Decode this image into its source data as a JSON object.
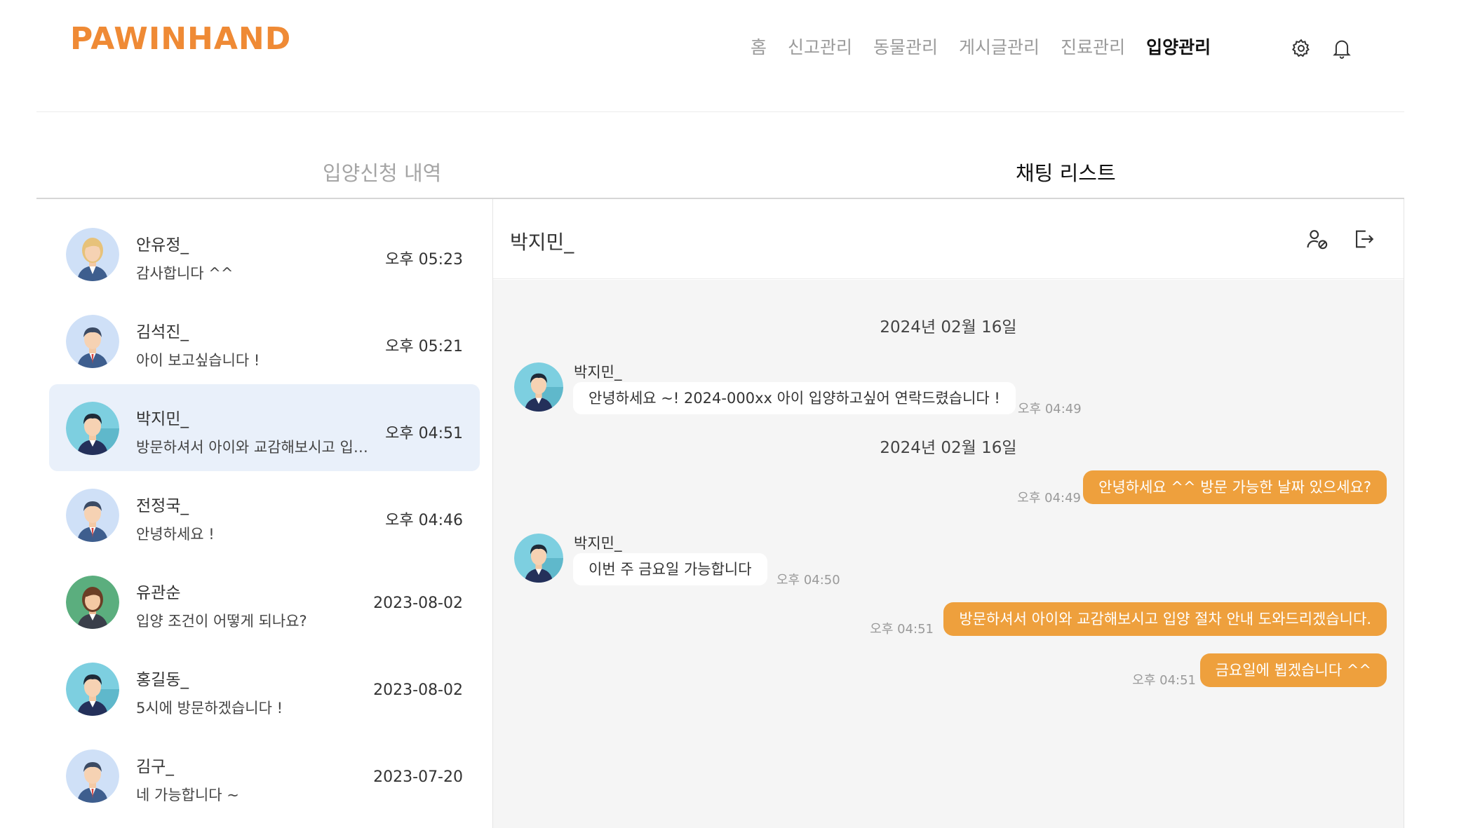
{
  "header": {
    "logo": "PAWINHAND",
    "nav": [
      "홈",
      "신고관리",
      "동물관리",
      "게시글관리",
      "진료관리",
      "입양관리"
    ],
    "active_nav": "입양관리",
    "icons": [
      "settings-icon",
      "bell-icon"
    ]
  },
  "tabs": {
    "apply_history": "입양신청 내역",
    "chat_list": "채팅 리스트"
  },
  "chat_list": [
    {
      "name": "안유정_",
      "preview": "감사합니다 ^^",
      "time": "오후 05:23",
      "avatar": "woman-blonde"
    },
    {
      "name": "김석진_",
      "preview": "아이 보고싶습니다 !",
      "time": "오후 05:21",
      "avatar": "man-suit"
    },
    {
      "name": "박지민_",
      "preview": "방문하셔서 아이와 교감해보시고 입양 절차 안내 도와드리겠습니다.",
      "time": "오후 04:51",
      "avatar": "man-teal"
    },
    {
      "name": "전정국_",
      "preview": "안녕하세요 !",
      "time": "오후 04:46",
      "avatar": "man-suit"
    },
    {
      "name": "유관순",
      "preview": "입양 조건이 어떻게 되나요?",
      "time": "2023-08-02",
      "avatar": "woman-green"
    },
    {
      "name": "홍길동_",
      "preview": "5시에 방문하겠습니다 !",
      "time": "2023-08-02",
      "avatar": "man-teal"
    },
    {
      "name": "김구_",
      "preview": "네 가능합니다 ~",
      "time": "2023-07-20",
      "avatar": "man-suit"
    }
  ],
  "conversation": {
    "title": "박지민_",
    "icons": [
      "user-block-icon",
      "exit-icon"
    ],
    "messages": [
      {
        "type": "date",
        "text": "2024년 02월 16일"
      },
      {
        "type": "in",
        "sender": "박지민_",
        "text": "안녕하세요 ~! 2024-000xx 아이 입양하고싶어 연락드렸습니다 !",
        "time": "오후 04:49"
      },
      {
        "type": "date",
        "text": "2024년 02월 16일"
      },
      {
        "type": "out",
        "text": "안녕하세요 ^^ 방문 가능한 날짜 있으세요?",
        "time": "오후 04:49"
      },
      {
        "type": "in",
        "sender": "박지민_",
        "text": "이번 주 금요일 가능합니다",
        "time": "오후 04:50"
      },
      {
        "type": "out",
        "text": "방문하셔서 아이와 교감해보시고 입양 절차 안내 도와드리겠습니다.",
        "time": "오후 04:51"
      },
      {
        "type": "out",
        "text": "금요일에 뵙겠습니다 ^^",
        "time": "오후 04:51"
      }
    ]
  },
  "colors": {
    "brand": "#EF8A35",
    "bubble_out": "#EEA03D",
    "selected_row": "#E9F0FA",
    "chat_bg": "#F5F5F5"
  }
}
